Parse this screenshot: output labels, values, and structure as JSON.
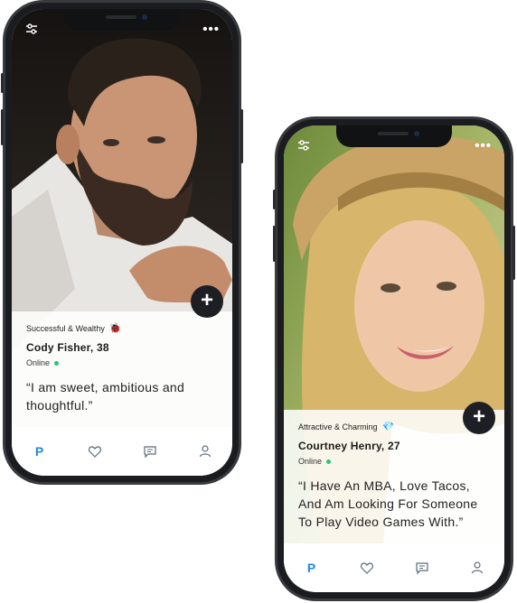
{
  "profiles": [
    {
      "tagline": "Successful & Wealthy",
      "tagline_emoji": "🐞",
      "name": "Cody Fisher, 38",
      "status": "Online",
      "quote": "“I am sweet, ambitious and thoughtful.”",
      "add_label": "+"
    },
    {
      "tagline": "Attractive & Charming",
      "tagline_emoji": "💎",
      "name": "Courtney Henry, 27",
      "status": "Online",
      "quote": "“I Have An MBA, Love Tacos, And Am Looking For Someone To Play Video Games With.”",
      "add_label": "+"
    }
  ],
  "tabbar": {
    "home_label": "P",
    "icons": [
      "heart-icon",
      "chat-icon",
      "profile-icon"
    ]
  },
  "top_icons": {
    "filter": "filter-icon",
    "more": "•••"
  },
  "colors": {
    "accent": "#1e88e5",
    "online": "#28c76f",
    "plus_button": "#1d1f24"
  }
}
